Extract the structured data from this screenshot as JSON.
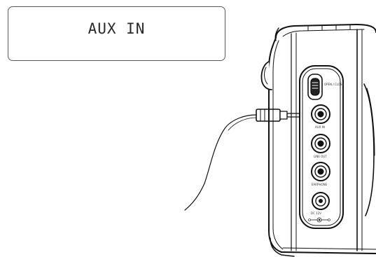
{
  "display": {
    "text": "AUX IN"
  },
  "panel_labels": {
    "switch": "OPEN / CLOSE",
    "aux_in": "AUX IN",
    "line_out": "LINE OUT",
    "earphone": "EARPHONE",
    "dc_in": "DC 12V"
  }
}
